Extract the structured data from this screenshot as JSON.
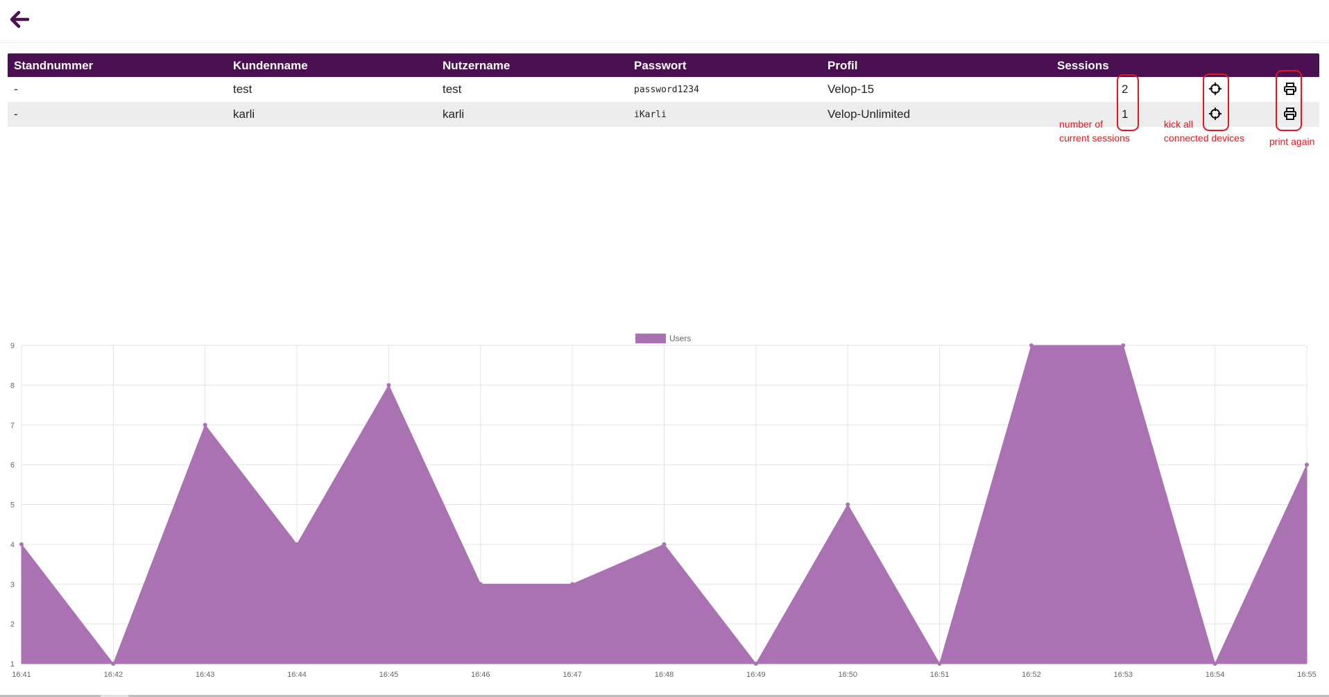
{
  "nav": {
    "back_icon": "arrow-left-icon",
    "accent_color": "#4a1051"
  },
  "table": {
    "headers": [
      "Standnummer",
      "Kundenname",
      "Nutzername",
      "Passwort",
      "Profil",
      "Sessions"
    ],
    "header_bg": "#4a1051",
    "rows": [
      {
        "standnummer": "-",
        "kundenname": "test",
        "nutzername": "test",
        "passwort": "password1234",
        "profil": "Velop-15",
        "sessions": "2",
        "kick_icon": "crosshair-icon",
        "print_icon": "printer-icon"
      },
      {
        "standnummer": "-",
        "kundenname": "karli",
        "nutzername": "karli",
        "passwort": "iKarli",
        "profil": "Velop-Unlimited",
        "sessions": "1",
        "kick_icon": "crosshair-icon",
        "print_icon": "printer-icon"
      }
    ]
  },
  "annotations": {
    "color": "#e8141a",
    "sessions_note": "number of\ncurrent sessions",
    "kick_note": "kick all\nconnected devices",
    "print_note": "print again"
  },
  "chart_data": {
    "type": "area",
    "x": [
      "16:41",
      "16:42",
      "16:43",
      "16:44",
      "16:45",
      "16:46",
      "16:47",
      "16:48",
      "16:49",
      "16:50",
      "16:51",
      "16:52",
      "16:53",
      "16:54",
      "16:55"
    ],
    "series": [
      {
        "name": "Users",
        "values": [
          4,
          1,
          7,
          4,
          8,
          3,
          3,
          4,
          1,
          5,
          1,
          9,
          9,
          1,
          6
        ],
        "color": "#ab72b3"
      }
    ],
    "ylim": [
      1,
      9
    ],
    "yticks": [
      1,
      2,
      3,
      4,
      5,
      6,
      7,
      8,
      9
    ],
    "grid": true,
    "legend": "top-center"
  }
}
